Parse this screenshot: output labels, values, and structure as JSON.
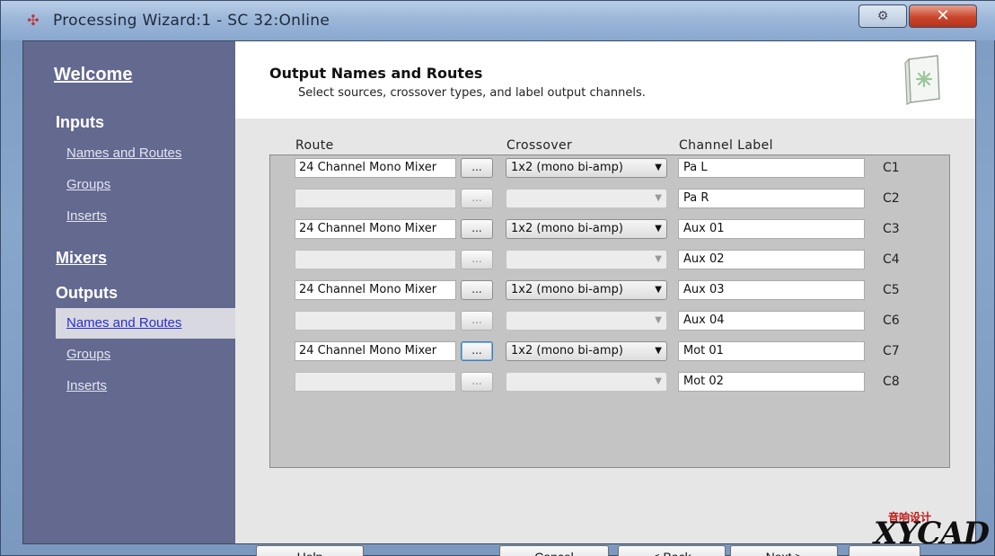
{
  "window": {
    "title": "Processing Wizard:1 - SC 32:Online",
    "close_glyph": "✕",
    "help_glyph": "⚙"
  },
  "sidebar": {
    "welcome": "Welcome",
    "inputs": {
      "heading": "Inputs",
      "items": [
        "Names and Routes",
        "Groups",
        "Inserts"
      ]
    },
    "mixers": "Mixers",
    "outputs": {
      "heading": "Outputs",
      "items": [
        "Names and Routes",
        "Groups",
        "Inserts"
      ],
      "active_index": 0
    }
  },
  "header": {
    "title": "Output Names and Routes",
    "subtitle": "Select sources, crossover types, and label output channels."
  },
  "columns": {
    "route": "Route",
    "crossover": "Crossover",
    "channel_label": "Channel Label"
  },
  "rows": [
    {
      "route": "24 Channel Mono Mixer",
      "browse": "...",
      "crossover": "1x2 (mono bi-amp)",
      "label": "Pa L",
      "id": "C1"
    },
    {
      "route": "",
      "browse": "...",
      "crossover": "",
      "label": "Pa R",
      "id": "C2"
    },
    {
      "route": "24 Channel Mono Mixer",
      "browse": "...",
      "crossover": "1x2 (mono bi-amp)",
      "label": "Aux 01",
      "id": "C3"
    },
    {
      "route": "",
      "browse": "...",
      "crossover": "",
      "label": "Aux 02",
      "id": "C4"
    },
    {
      "route": "24 Channel Mono Mixer",
      "browse": "...",
      "crossover": "1x2 (mono bi-amp)",
      "label": "Aux 03",
      "id": "C5"
    },
    {
      "route": "",
      "browse": "...",
      "crossover": "",
      "label": "Aux 04",
      "id": "C6"
    },
    {
      "route": "24 Channel Mono Mixer",
      "browse": "...",
      "crossover": "1x2 (mono bi-amp)",
      "label": "Mot 01",
      "id": "C7"
    },
    {
      "route": "",
      "browse": "...",
      "crossover": "",
      "label": "Mot 02",
      "id": "C8"
    }
  ],
  "footer": {
    "help": "Help",
    "cancel": "Cancel",
    "back": "< Back",
    "next": "Next >"
  },
  "watermark": {
    "cn": "音响设计",
    "en": "XYCAD"
  },
  "colors": {
    "sidebar_bg": "#63698f",
    "active_link": "#2a2fd0",
    "close_button": "#c9462c"
  }
}
